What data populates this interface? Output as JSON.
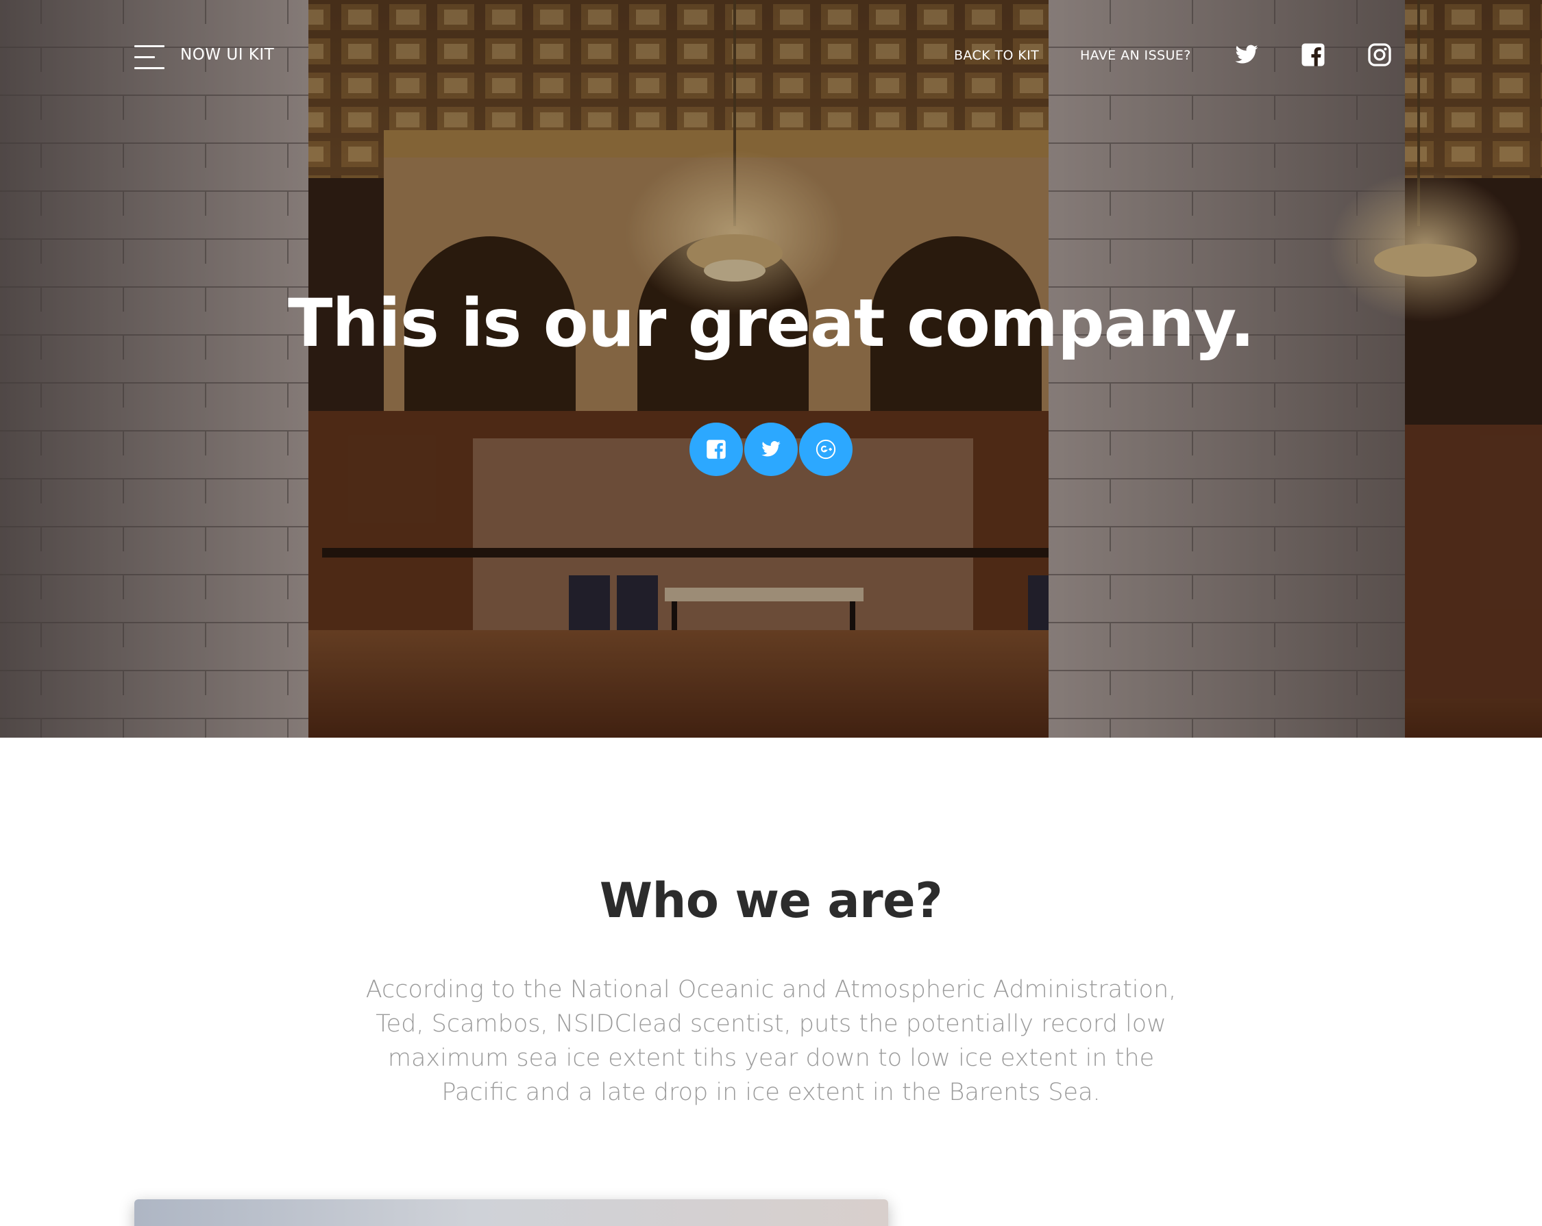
{
  "navbar": {
    "brand": "NOW UI KIT",
    "links": [
      {
        "label": "BACK TO KIT"
      },
      {
        "label": "HAVE AN ISSUE?"
      }
    ],
    "social_icons": [
      "twitter-icon",
      "facebook-icon",
      "instagram-icon"
    ]
  },
  "hero": {
    "title": "This is our great company.",
    "share_buttons": [
      "facebook-icon",
      "twitter-icon",
      "google-plus-icon"
    ],
    "share_color": "#2ca8ff"
  },
  "about": {
    "title": "Who we are?",
    "description": "According to the National Oceanic and Atmospheric Administration, Ted, Scambos, NSIDClead scentist, puts the potentially record low maximum sea ice extent tihs year down to low ice extent in the Pacific and a late drop in ice extent in the Barents Sea."
  }
}
